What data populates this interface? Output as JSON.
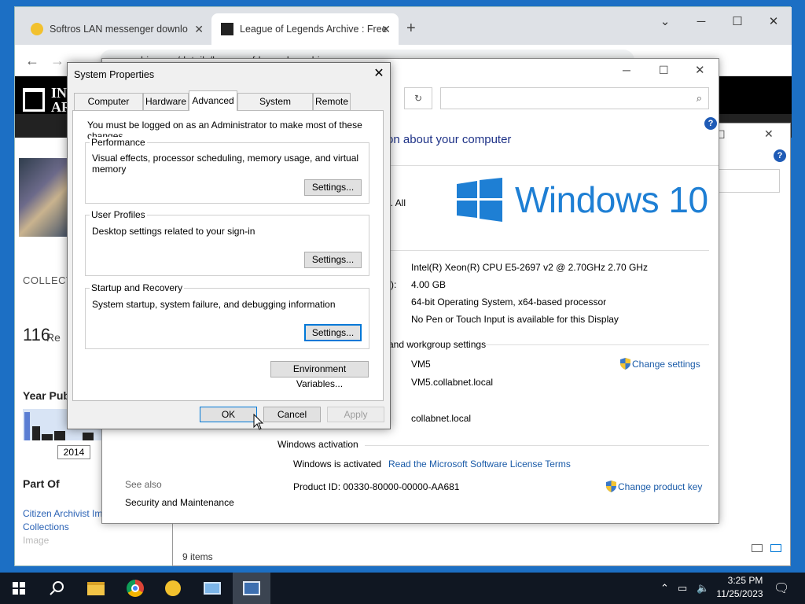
{
  "chrome": {
    "tab1_title": "Softros LAN messenger downlo",
    "tab2_title": "League of Legends Archive : Free",
    "new_tab": "+",
    "url": "archive.org/details/league-of-legends-archive",
    "minimize": "─",
    "maximize": "☐",
    "close": "✕",
    "back": "←",
    "forward": "→",
    "collapse": "⌄"
  },
  "archive": {
    "logo_line1": "IN",
    "logo_line2": "AR",
    "collection": "COLLECT",
    "count": "116",
    "count_suffix": "Re",
    "year_pub": "Year Pub",
    "year_from": "2014",
    "part_of": "Part Of",
    "link1": "Citizen Archivist Im",
    "link2": "Collections",
    "link3": "Image"
  },
  "explorer": {
    "status": "9 items"
  },
  "system": {
    "heading": "on about your computer",
    "windows_text": "Windows 10",
    "rights_fragment": "n. All",
    "processor": "Intel(R) Xeon(R) CPU E5-2697 v2 @ 2.70GHz   2.70 GHz",
    "ram_label_fragment": "):",
    "ram": "4.00 GB",
    "system_type": "64-bit Operating System, x64-based processor",
    "pen_touch": "No Pen or Touch Input is available for this Display",
    "section_name": "and workgroup settings",
    "computer_name": "VM5",
    "full_name": "VM5.collabnet.local",
    "domain": "collabnet.local",
    "change_settings": "Change settings",
    "activation_header": "Windows activation",
    "activated": "Windows is activated",
    "license_link": "Read the Microsoft Software License Terms",
    "product_id": "Product ID:  00330-80000-00000-AA681",
    "change_key": "Change product key",
    "see_also": "See also",
    "security": "Security and Maintenance"
  },
  "dialog": {
    "title": "System Properties",
    "close": "✕",
    "tabs": [
      "Computer Name",
      "Hardware",
      "Advanced",
      "System Protection",
      "Remote"
    ],
    "admin_note": "You must be logged on as an Administrator to make most of these changes.",
    "performance": {
      "title": "Performance",
      "desc": "Visual effects, processor scheduling, memory usage, and virtual memory",
      "button": "Settings..."
    },
    "user_profiles": {
      "title": "User Profiles",
      "desc": "Desktop settings related to your sign-in",
      "button": "Settings..."
    },
    "startup": {
      "title": "Startup and Recovery",
      "desc": "System startup, system failure, and debugging information",
      "button": "Settings..."
    },
    "env_vars": "Environment Variables...",
    "ok": "OK",
    "cancel": "Cancel",
    "apply": "Apply"
  },
  "taskbar": {
    "time": "3:25 PM",
    "date": "11/25/2023"
  },
  "colors": {
    "desktop": "#1c6fc4",
    "taskbar": "#101722",
    "link": "#1a5ba8",
    "focus": "#0078d7",
    "win10_blue": "#1e7fd4"
  }
}
